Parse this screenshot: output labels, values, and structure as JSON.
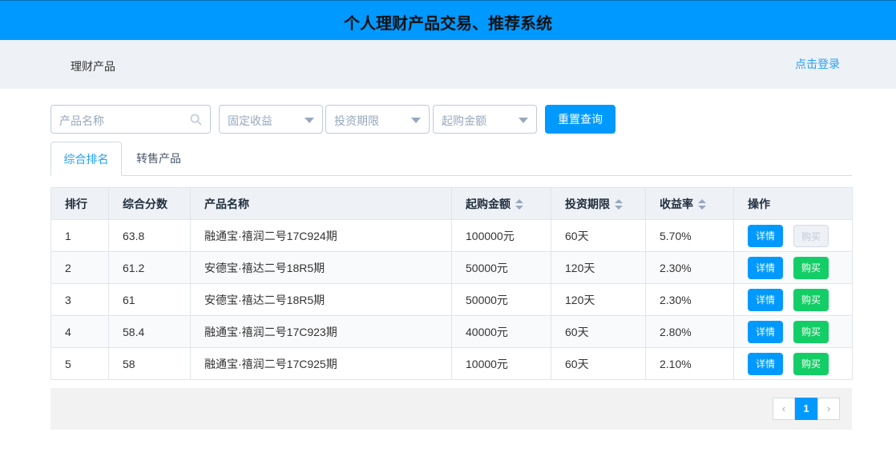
{
  "header": {
    "title": "个人理财产品交易、推荐系统"
  },
  "nav": {
    "menu_item": "理财产品",
    "login_link": "点击登录"
  },
  "filters": {
    "name_placeholder": "产品名称",
    "income_type": "固定收益",
    "term": "投资期限",
    "min_amount": "起购金额",
    "reset_button": "重置查询"
  },
  "tabs": [
    {
      "label": "综合排名",
      "active": true
    },
    {
      "label": "转售产品",
      "active": false
    }
  ],
  "table": {
    "columns": [
      "排行",
      "综合分数",
      "产品名称",
      "起购金额",
      "投资期限",
      "收益率",
      "操作"
    ],
    "detail_label": "详情",
    "buy_label": "购买",
    "rows": [
      {
        "rank": "1",
        "score": "63.8",
        "name": "融通宝·禧润二号17C924期",
        "amount": "100000元",
        "term": "60天",
        "rate": "5.70%"
      },
      {
        "rank": "2",
        "score": "61.2",
        "name": "安德宝·禧达二号18R5期",
        "amount": "50000元",
        "term": "120天",
        "rate": "2.30%"
      },
      {
        "rank": "3",
        "score": "61",
        "name": "安德宝·禧达二号18R5期",
        "amount": "50000元",
        "term": "120天",
        "rate": "2.30%"
      },
      {
        "rank": "4",
        "score": "58.4",
        "name": "融通宝·禧润二号17C923期",
        "amount": "40000元",
        "term": "60天",
        "rate": "2.80%"
      },
      {
        "rank": "5",
        "score": "58",
        "name": "融通宝·禧润二号17C925期",
        "amount": "10000元",
        "term": "60天",
        "rate": "2.10%"
      }
    ]
  },
  "pagination": {
    "prev": "‹",
    "current": "1",
    "next": "›"
  },
  "colors": {
    "primary": "#0099ff",
    "success": "#13ce66",
    "header_bg": "#eef1f6"
  }
}
